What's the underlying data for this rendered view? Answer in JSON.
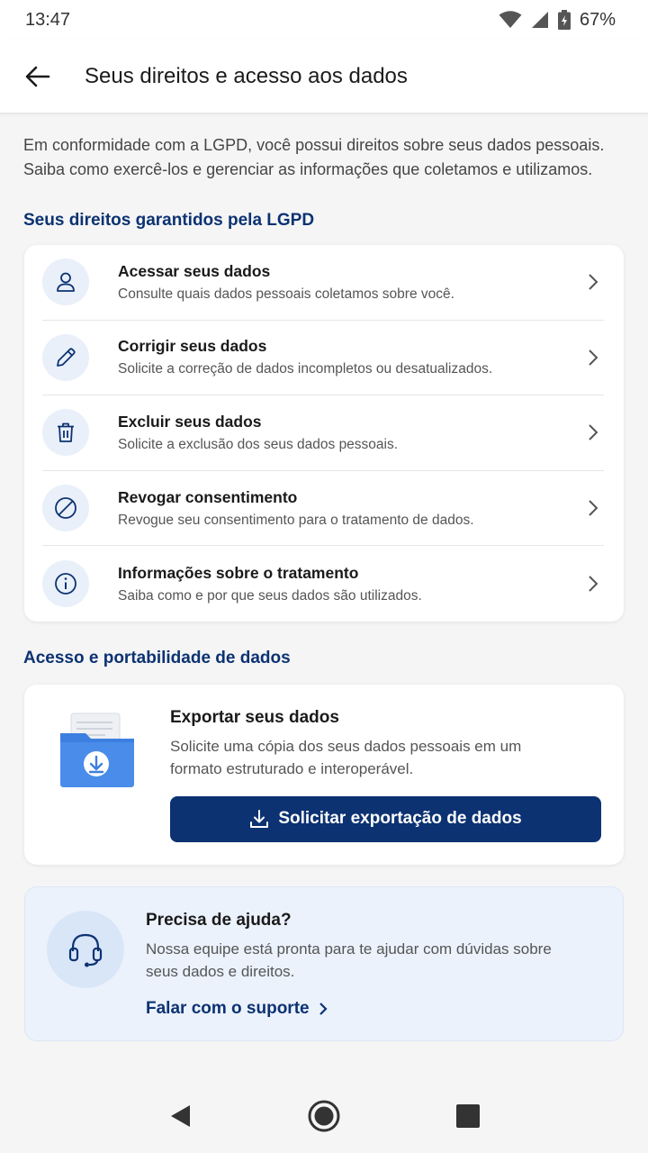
{
  "status_bar": {
    "time": "13:47",
    "battery": "67%"
  },
  "app_bar": {
    "title": "Seus direitos e acesso aos dados"
  },
  "intro": "Em conformidade com a LGPD, você possui direitos sobre seus dados pessoais. Saiba como exercê-los e gerenciar as informações que coletamos e utilizamos.",
  "rights_section": {
    "title": "Seus direitos garantidos pela LGPD",
    "items": [
      {
        "icon": "person-icon",
        "title": "Acessar seus dados",
        "desc": "Consulte quais dados pessoais coletamos sobre você."
      },
      {
        "icon": "pencil-icon",
        "title": "Corrigir seus dados",
        "desc": "Solicite a correção de dados incompletos ou desatualizados."
      },
      {
        "icon": "trash-icon",
        "title": "Excluir seus dados",
        "desc": "Solicite a exclusão dos seus dados pessoais."
      },
      {
        "icon": "block-icon",
        "title": "Revogar consentimento",
        "desc": "Revogue seu consentimento para o tratamento de dados."
      },
      {
        "icon": "info-icon",
        "title": "Informações sobre o tratamento",
        "desc": "Saiba como e por que seus dados são utilizados."
      }
    ]
  },
  "portability_section": {
    "title": "Acesso e portabilidade de dados",
    "export_title": "Exportar seus dados",
    "export_desc": "Solicite uma cópia dos seus dados pessoais em um formato estruturado e interoperável.",
    "export_button": "Solicitar exportação de dados"
  },
  "help": {
    "title": "Precisa de ajuda?",
    "desc": "Nossa equipe está pronta para te ajudar com dúvidas sobre seus dados e direitos.",
    "link": "Falar com o suporte"
  },
  "colors": {
    "primary": "#0c3272",
    "icon_bg": "#e9f0fa",
    "help_bg": "#ebf2fc",
    "folder": "#3d7fe0"
  }
}
